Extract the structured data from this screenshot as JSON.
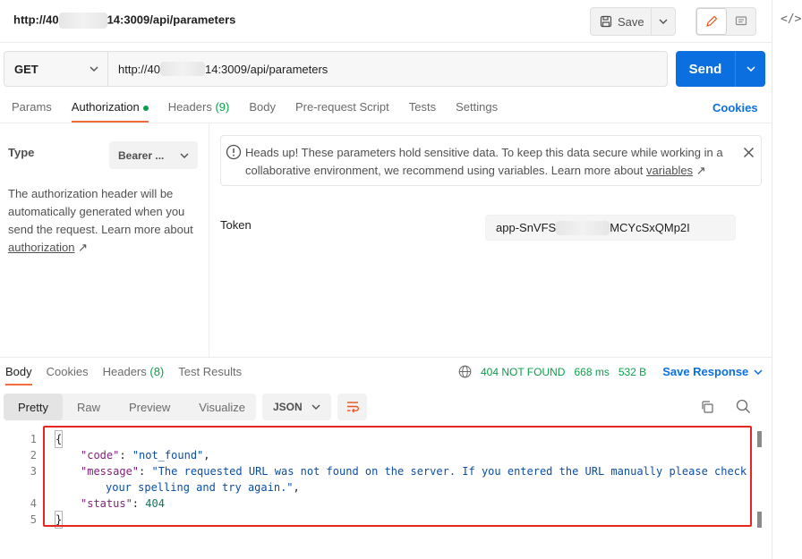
{
  "header": {
    "request_title_prefix": "http://40",
    "request_title_suffix": "14:3009/api/parameters",
    "save_label": "Save",
    "code_toggle_label": "</>"
  },
  "url_bar": {
    "method": "GET",
    "url_prefix": "http://40",
    "url_suffix": "14:3009/api/parameters",
    "send_label": "Send"
  },
  "request_tabs": [
    {
      "label": "Params",
      "count": ""
    },
    {
      "label": "Authorization",
      "count": "",
      "active": true,
      "dot": true
    },
    {
      "label": "Headers",
      "count": "(9)"
    },
    {
      "label": "Body",
      "count": ""
    },
    {
      "label": "Pre-request Script",
      "count": ""
    },
    {
      "label": "Tests",
      "count": ""
    },
    {
      "label": "Settings",
      "count": ""
    }
  ],
  "cookies_label": "Cookies",
  "auth": {
    "type_label": "Type",
    "type_value": "Bearer ...",
    "description": "The authorization header will be automatically generated when you send the request. Learn more about",
    "description_link": "authorization",
    "link_arrow": "↗",
    "alert_text": "Heads up! These parameters hold sensitive data. To keep this data secure while working in a collaborative environment, we recommend using variables. Learn more about",
    "alert_link": "variables",
    "token_label": "Token",
    "token_prefix": "app-SnVFS",
    "token_suffix": "MCYcSxQMp2I"
  },
  "response_tabs": [
    {
      "label": "Body",
      "count": "",
      "active": true
    },
    {
      "label": "Cookies",
      "count": ""
    },
    {
      "label": "Headers",
      "count": "(8)"
    },
    {
      "label": "Test Results",
      "count": ""
    }
  ],
  "response_status": {
    "code": "404 NOT FOUND",
    "time": "668 ms",
    "size": "532 B",
    "save_response_label": "Save Response"
  },
  "format_bar": {
    "modes": [
      "Pretty",
      "Raw",
      "Preview",
      "Visualize"
    ],
    "active_mode": "Pretty",
    "language": "JSON"
  },
  "code": {
    "line_numbers": [
      "1",
      "2",
      "3",
      "4",
      "5"
    ],
    "open_brace": "{",
    "code_key": "\"code\"",
    "code_value": "\"not_found\"",
    "message_key": "\"message\"",
    "message_value_line1": "\"The requested URL was not found on the server. If you entered the URL manually please check",
    "message_value_line2": "your spelling and try again.\"",
    "status_key": "\"status\"",
    "status_value": "404",
    "close_brace": "}"
  },
  "colors": {
    "accent_tab": "#f26b3a",
    "send_blue": "#0b6fe0",
    "status_green": "#0aa04a",
    "highlight_red": "#e8251f"
  }
}
